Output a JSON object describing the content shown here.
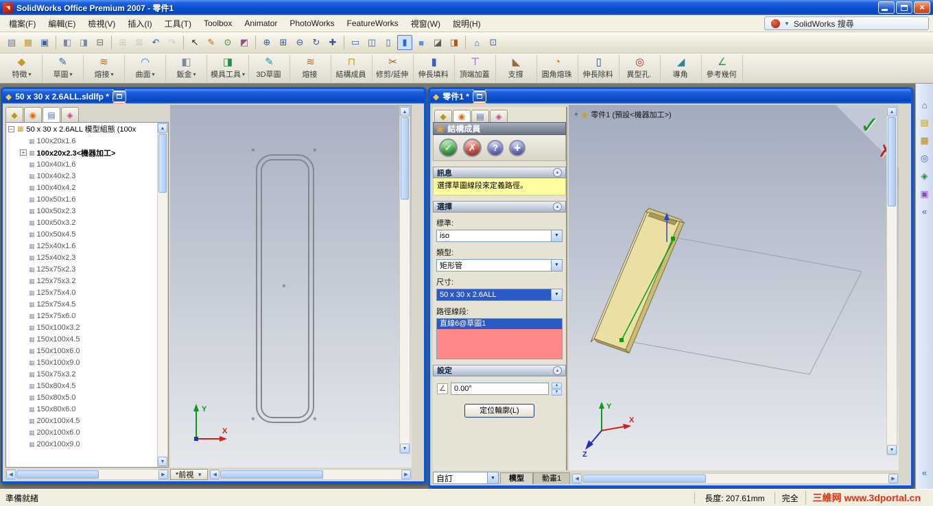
{
  "titlebar": {
    "title": "SolidWorks Office Premium 2007 - 零件1"
  },
  "menubar": {
    "items": [
      "檔案(F)",
      "編輯(E)",
      "檢視(V)",
      "插入(I)",
      "工具(T)",
      "Toolbox",
      "Animator",
      "PhotoWorks",
      "FeatureWorks",
      "視窗(W)",
      "說明(H)"
    ],
    "search_label": "SolidWorks 搜尋"
  },
  "toolbar_standard": {
    "icons": [
      {
        "name": "new-icon",
        "glyph": "▤",
        "color": "#5a78b0",
        "cls": "ticon"
      },
      {
        "name": "open-icon",
        "glyph": "▦",
        "color": "#c89a28",
        "cls": "ticon"
      },
      {
        "name": "save-icon",
        "glyph": "▣",
        "color": "#3a62a8",
        "cls": "ticon"
      },
      {
        "name": "separator",
        "cls": "tsep"
      },
      {
        "name": "make-drawing-icon",
        "glyph": "◧",
        "color": "#7a8aa8",
        "cls": "ticon"
      },
      {
        "name": "make-assembly-icon",
        "glyph": "◨",
        "color": "#7a8aa8",
        "cls": "ticon"
      },
      {
        "name": "print-icon",
        "glyph": "⊟",
        "color": "#6a6a6a",
        "cls": "ticon"
      },
      {
        "name": "separator",
        "cls": "tsep"
      },
      {
        "name": "copy-icon",
        "glyph": "⊞",
        "color": "#8a8a8a",
        "cls": "ticon disabled"
      },
      {
        "name": "paste-icon",
        "glyph": "⊠",
        "color": "#8a8a8a",
        "cls": "ticon disabled"
      },
      {
        "name": "undo-icon",
        "glyph": "↶",
        "color": "#3a62a8",
        "cls": "ticon"
      },
      {
        "name": "redo-icon",
        "glyph": "↷",
        "color": "#8a8a8a",
        "cls": "ticon disabled"
      },
      {
        "name": "separator",
        "cls": "tsep"
      },
      {
        "name": "select-icon",
        "glyph": "↖",
        "color": "#222222",
        "cls": "ticon"
      },
      {
        "name": "sketch-icon",
        "glyph": "✎",
        "color": "#c06414",
        "cls": "ticon"
      },
      {
        "name": "rebuild-icon",
        "glyph": "⊙",
        "color": "#2a8a2a",
        "cls": "ticon"
      },
      {
        "name": "edit-color-icon",
        "glyph": "◩",
        "color": "#a04a8a",
        "cls": "ticon"
      },
      {
        "name": "separator",
        "cls": "tsep"
      },
      {
        "name": "zoom-fit-icon",
        "glyph": "⊕",
        "color": "#34589a",
        "cls": "ticon"
      },
      {
        "name": "zoom-area-icon",
        "glyph": "⊞",
        "color": "#34589a",
        "cls": "ticon"
      },
      {
        "name": "zoom-in-out-icon",
        "glyph": "⊖",
        "color": "#34589a",
        "cls": "ticon"
      },
      {
        "name": "rotate-view-icon",
        "glyph": "↻",
        "color": "#34589a",
        "cls": "ticon"
      },
      {
        "name": "pan-icon",
        "glyph": "✚",
        "color": "#34589a",
        "cls": "ticon"
      },
      {
        "name": "separator",
        "cls": "tsep"
      },
      {
        "name": "wireframe-icon",
        "glyph": "▭",
        "color": "#3a62a8",
        "cls": "ticon"
      },
      {
        "name": "hidden-lines-visible-icon",
        "glyph": "◫",
        "color": "#3a62a8",
        "cls": "ticon"
      },
      {
        "name": "hidden-lines-removed-icon",
        "glyph": "▯",
        "color": "#3a62a8",
        "cls": "ticon"
      },
      {
        "name": "shaded-with-edges-icon",
        "glyph": "▮",
        "color": "#2a6ac8",
        "cls": "ticon active"
      },
      {
        "name": "shaded-icon",
        "glyph": "■",
        "color": "#5a94e0",
        "cls": "ticon"
      },
      {
        "name": "shadows-icon",
        "glyph": "◪",
        "color": "#5a5a5a",
        "cls": "ticon"
      },
      {
        "name": "section-view-icon",
        "glyph": "◨",
        "color": "#a85a28",
        "cls": "ticon"
      },
      {
        "name": "separator",
        "cls": "tsep"
      },
      {
        "name": "view-orientation-icon",
        "glyph": "⌂",
        "color": "#3a62a8",
        "cls": "ticon"
      },
      {
        "name": "standard-views-icon",
        "glyph": "⊡",
        "color": "#3a62a8",
        "cls": "ticon"
      }
    ]
  },
  "toolbar_command": {
    "buttons": [
      {
        "label": "特徵",
        "glyph": "◆",
        "color": "#c89a20",
        "arrow_glyph": "▾"
      },
      {
        "label": "草圖",
        "glyph": "✎",
        "color": "#2a62c8",
        "arrow_glyph": "▾"
      },
      {
        "label": "熔接",
        "glyph": "≋",
        "color": "#c06a1a",
        "arrow_glyph": "▾"
      },
      {
        "label": "曲面",
        "glyph": "◠",
        "color": "#3a7ac8",
        "arrow_glyph": "▾"
      },
      {
        "label": "鈑金",
        "glyph": "◧",
        "color": "#7a8aa0",
        "arrow_glyph": "▾"
      },
      {
        "label": "模具工具",
        "glyph": "◨",
        "color": "#2a8a4a",
        "arrow_glyph": "▾"
      },
      {
        "label": "3D草圖",
        "glyph": "✎",
        "color": "#189898"
      },
      {
        "label": "熔接",
        "glyph": "≋",
        "color": "#c06a1a"
      },
      {
        "label": "結構成員",
        "glyph": "⊓",
        "color": "#c89a20"
      },
      {
        "label": "修剪/延伸",
        "glyph": "✂",
        "color": "#98552a"
      },
      {
        "label": "伸長填料",
        "glyph": "▮",
        "color": "#3a62b8"
      },
      {
        "label": "頂端加蓋",
        "glyph": "⊤",
        "color": "#8050b8"
      },
      {
        "label": "支撐",
        "glyph": "◣",
        "color": "#9a6a38"
      },
      {
        "label": "圓角熔珠",
        "glyph": "◔",
        "color": "#cc7a28"
      },
      {
        "label": "伸長除料",
        "glyph": "▯",
        "color": "#2a4878"
      },
      {
        "label": "異型孔.",
        "glyph": "◎",
        "color": "#a83030"
      },
      {
        "label": "導角",
        "glyph": "◢",
        "color": "#288aa0"
      },
      {
        "label": "參考幾何",
        "glyph": "∠",
        "color": "#2a9a48"
      }
    ]
  },
  "left_window": {
    "title": "50 x 30 x 2.6ALL.sldlfp *",
    "tabs": [
      {
        "name": "featuremanager-tab-icon",
        "glyph": "◆",
        "color": "#b89a18",
        "cls": ""
      },
      {
        "name": "propertymanager-tab-icon",
        "glyph": "◉",
        "color": "#d87018",
        "cls": ""
      },
      {
        "name": "configurationmanager-tab-icon",
        "glyph": "▤",
        "color": "#4a6ab8",
        "cls": "active"
      },
      {
        "name": "addins-tab-icon",
        "glyph": "◈",
        "color": "#b84a90",
        "cls": ""
      }
    ],
    "tree_root": "50 x 30 x 2.6ALL 模型組態 (100x",
    "configs": [
      {
        "label": "100x20x1.6"
      },
      {
        "label": "100x20x2.3<機器加工>",
        "cls": "bold",
        "expand": "+",
        "ecls": "ebox"
      },
      {
        "label": "100x40x1.6"
      },
      {
        "label": "100x40x2.3"
      },
      {
        "label": "100x40x4.2"
      },
      {
        "label": "100x50x1.6"
      },
      {
        "label": "100x50x2.3"
      },
      {
        "label": "100x50x3.2"
      },
      {
        "label": "100x50x4.5"
      },
      {
        "label": "125x40x1.6"
      },
      {
        "label": "125x40x2.3"
      },
      {
        "label": "125x75x2.3"
      },
      {
        "label": "125x75x3.2"
      },
      {
        "label": "125x75x4.0"
      },
      {
        "label": "125x75x4.5"
      },
      {
        "label": "125x75x6.0"
      },
      {
        "label": "150x100x3.2"
      },
      {
        "label": "150x100x4.5"
      },
      {
        "label": "150x100x6.0"
      },
      {
        "label": "150x100x9.0"
      },
      {
        "label": "150x75x3.2"
      },
      {
        "label": "150x80x4.5"
      },
      {
        "label": "150x80x5.0"
      },
      {
        "label": "150x80x6.0"
      },
      {
        "label": "200x100x4.5"
      },
      {
        "label": "200x100x6.0"
      },
      {
        "label": "200x100x9.0"
      }
    ],
    "view_tab": "*前視"
  },
  "right_window": {
    "title": "零件1 *",
    "tabs": [
      {
        "name": "featuremanager-tab-icon",
        "glyph": "◆",
        "color": "#b89a18",
        "cls": ""
      },
      {
        "name": "propertymanager-tab-icon",
        "glyph": "◉",
        "color": "#d87018",
        "cls": "active"
      },
      {
        "name": "configurationmanager-tab-icon",
        "glyph": "▤",
        "color": "#4a6ab8",
        "cls": ""
      },
      {
        "name": "addins-tab-icon",
        "glyph": "◈",
        "color": "#b84a90",
        "cls": ""
      }
    ],
    "pm": {
      "title": "結構成員",
      "message_header": "訊息",
      "message": "選擇草圖線段來定義路徑。",
      "selection_header": "選擇",
      "standard_label": "標準:",
      "standard_value": "iso",
      "type_label": "類型:",
      "type_value": "矩形管",
      "size_label": "尺寸:",
      "size_value": "50 x 30 x 2.6ALL",
      "path_label": "路徑線段:",
      "path_selected": "直線6@草圖1",
      "settings_header": "設定",
      "angle_value": "0.00°",
      "locate_button": "定位輪廓(L)"
    },
    "viewport": {
      "header": "零件1 (預設<機器加工>)",
      "custom": "自訂",
      "tabs": [
        {
          "label": "模型",
          "cls": "active"
        },
        {
          "label": "動畫1",
          "cls": ""
        }
      ]
    }
  },
  "triad": {
    "x": "X",
    "y": "Y",
    "z": "Z"
  },
  "taskpane": {
    "icons": [
      {
        "name": "solidworks-resources-icon",
        "glyph": "⌂",
        "color": "#2a5ac8"
      },
      {
        "name": "design-library-icon",
        "glyph": "▤",
        "color": "#c89a28"
      },
      {
        "name": "file-explorer-icon",
        "glyph": "▦",
        "color": "#b8862a"
      },
      {
        "name": "search-results-icon",
        "glyph": "◎",
        "color": "#3a62a8"
      },
      {
        "name": "view-palette-icon",
        "glyph": "◈",
        "color": "#2a8a4a"
      },
      {
        "name": "appearances-icon",
        "glyph": "▣",
        "color": "#8a4ac8"
      },
      {
        "name": "collapse-chevron-icon",
        "glyph": "«",
        "color": "#2a5ac8"
      }
    ],
    "bottom_icons": [
      {
        "name": "collapse-chevron-icon",
        "glyph": "«",
        "color": "#2a5ac8"
      }
    ]
  },
  "statusbar": {
    "ready": "準備就緒",
    "length": "長度: 207.61mm",
    "mode": "完全",
    "watermark": "三維网 www.3dportal.cn"
  },
  "colors": {
    "titlebar_blue": "#0a4ed0",
    "selection_blue": "#2a5ac8",
    "message_yellow": "#ffffa0",
    "path_list_pink": "#ff8888",
    "ok_green": "#1a8a1a",
    "cancel_red": "#c02818",
    "watermark_red": "#e03212"
  }
}
